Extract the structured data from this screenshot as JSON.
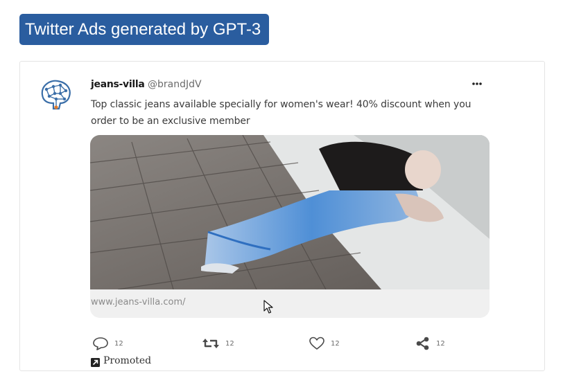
{
  "header": {
    "title": "Twitter Ads generated by GPT-3"
  },
  "tweet": {
    "author_name": "jeans-villa",
    "author_handle": "@brandJdV",
    "text": "Top classic jeans available specially for women's wear! 40% discount when you order to be an exclusive member",
    "link_url": "www.jeans-villa.com/",
    "actions": {
      "reply_count": "12",
      "retweet_count": "12",
      "like_count": "12",
      "share_count": "12"
    },
    "promoted_label": "Promoted"
  },
  "icons": {
    "avatar": "brain-network-icon",
    "more": "more-dots-icon",
    "reply": "reply-bubble-icon",
    "retweet": "retweet-icon",
    "like": "heart-icon",
    "share": "share-icon",
    "promoted": "promoted-arrow-icon",
    "cursor": "mouse-cursor-icon"
  },
  "colors": {
    "title_bg": "#2a5d9f",
    "brand_blue": "#3a6ea8"
  }
}
